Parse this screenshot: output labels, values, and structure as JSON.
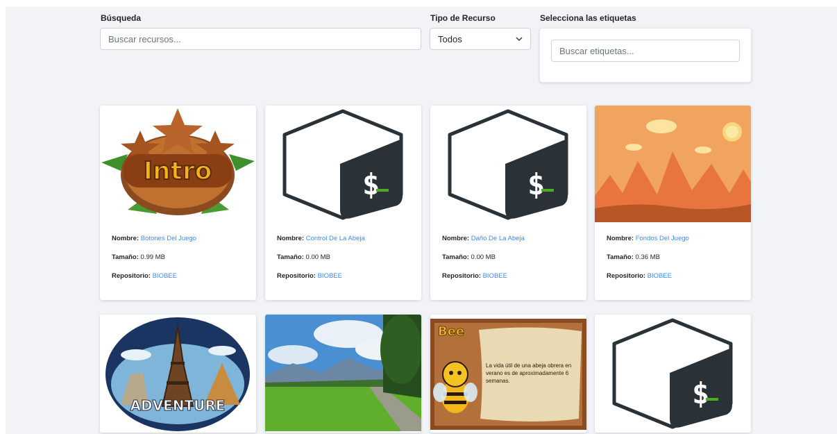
{
  "filters": {
    "search_label": "Búsqueda",
    "search_placeholder": "Buscar recursos...",
    "type_label": "Tipo de Recurso",
    "type_selected": "Todos",
    "tags_label": "Selecciona las etiquetas",
    "tags_placeholder": "Buscar etiquetas..."
  },
  "field_labels": {
    "name": "Nombre:",
    "size": "Tamaño:",
    "repo": "Repositorio:"
  },
  "cards": [
    {
      "name": "Botones Del Juego",
      "size": "0.99 MB",
      "repo": "BIOBEE",
      "thumb": "intro-badge",
      "thumb_text": "Intro"
    },
    {
      "name": "Control De La Abeja",
      "size": "0.00 MB",
      "repo": "BIOBEE",
      "thumb": "shell-script-icon"
    },
    {
      "name": "Daño De La Abeja",
      "size": "0.00 MB",
      "repo": "BIOBEE",
      "thumb": "shell-script-icon"
    },
    {
      "name": "Fondos Del Juego",
      "size": "0.36 MB",
      "repo": "BIOBEE",
      "thumb": "desert-landscape"
    },
    {
      "thumb": "eiffel-adventure-logo",
      "thumb_text": "ADVENTURE"
    },
    {
      "thumb": "green-field-landscape"
    },
    {
      "thumb": "bee-info-scroll",
      "thumb_title": "Bee",
      "thumb_text": "La vida útil de una abeja obrera en verano es de aproximadamente 6 semanas."
    },
    {
      "thumb": "shell-script-icon"
    }
  ],
  "colors": {
    "background": "#f1f3f7",
    "link": "#3d8be8",
    "shell_dark": "#2b3237",
    "shell_green": "#4eaa25",
    "desert_sky": "#f0a460",
    "desert_ground": "#b85625"
  }
}
